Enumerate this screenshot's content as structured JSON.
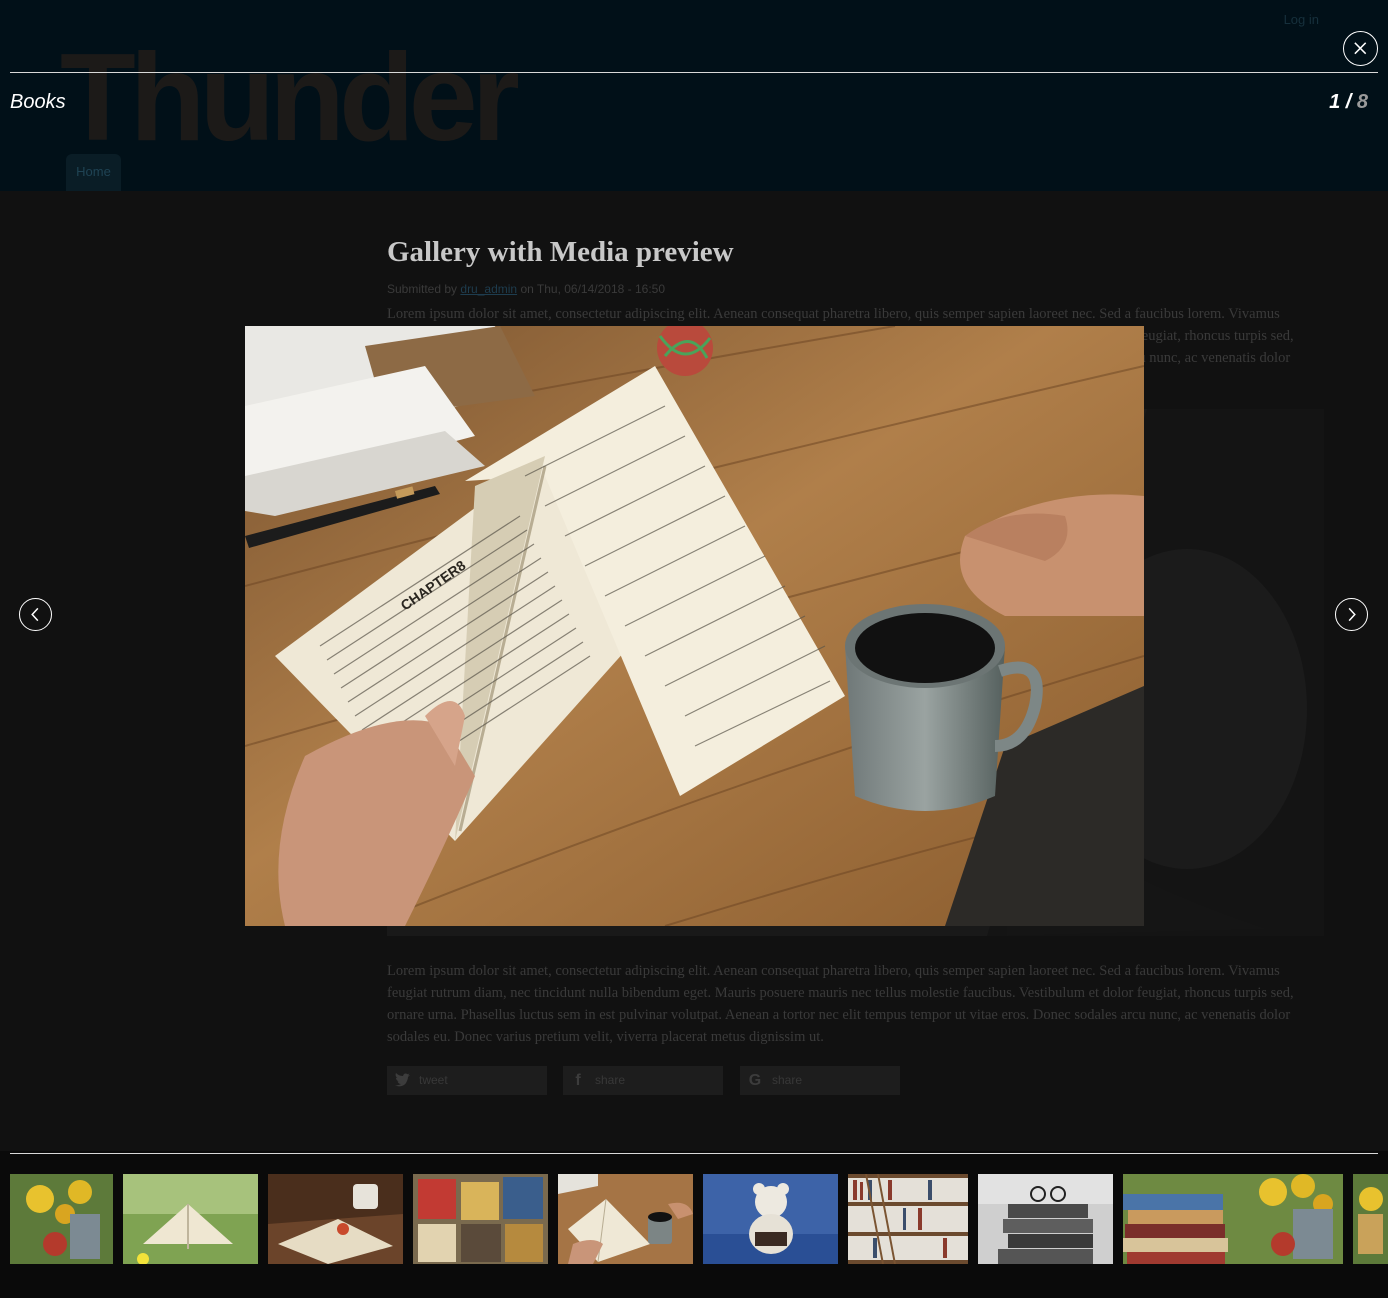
{
  "header": {
    "login_label": "Log in",
    "logo_text": "Thunder",
    "nav_home_label": "Home"
  },
  "article": {
    "title": "Gallery with Media preview",
    "submitted_prefix": "Submitted by",
    "author": "dru_admin",
    "submitted_suffix": "on Thu, 06/14/2018 - 16:50",
    "paragraph_top": "Lorem ipsum dolor sit amet, consectetur adipiscing elit. Aenean consequat pharetra libero, quis semper sapien laoreet nec. Sed a faucibus lorem. Vivamus feugiat rutrum diam, nec tincidunt nulla bibendum eget. Mauris posuere mauris nec tellus molestie faucibus. Vestibulum et dolor feugiat, rhoncus turpis sed, ornare urna. Phasellus luctus sem in est pulvinar volutpat. Aenean a tortor nec elit tempus tempor ut vitae eros. Donec sodales arcu nunc, ac venenatis dolor sodales eu.",
    "paragraph_bottom": "Lorem ipsum dolor sit amet, consectetur adipiscing elit. Aenean consequat pharetra libero, quis semper sapien laoreet nec. Sed a faucibus lorem. Vivamus feugiat rutrum diam, nec tincidunt nulla bibendum eget. Mauris posuere mauris nec tellus molestie faucibus. Vestibulum et dolor feugiat, rhoncus turpis sed, ornare urna. Phasellus luctus sem in est pulvinar volutpat. Aenean a tortor nec elit tempus tempor ut vitae eros. Donec sodales arcu nunc, ac venenatis dolor sodales eu. Donec varius pretium velit, viverra placerat metus dignissim ut.",
    "share": {
      "twitter_label": "tweet",
      "facebook_label": "share",
      "google_label": "share"
    }
  },
  "lightbox": {
    "gallery_title": "Books",
    "counter_current": "1",
    "counter_sep": " / ",
    "counter_total": "8",
    "close_icon": "close-icon",
    "prev_icon": "chevron-left-icon",
    "next_icon": "chevron-right-icon",
    "thumbnails": [
      {
        "name": "thumb-flowers-apple"
      },
      {
        "name": "thumb-open-book-grass"
      },
      {
        "name": "thumb-book-tea"
      },
      {
        "name": "thumb-magazines"
      },
      {
        "name": "thumb-book-coffee",
        "active": true
      },
      {
        "name": "thumb-teddy-bear"
      },
      {
        "name": "thumb-library-shelves"
      },
      {
        "name": "thumb-stacked-books-glasses"
      },
      {
        "name": "thumb-books-flowers"
      },
      {
        "name": "thumb-partial"
      }
    ]
  },
  "colors": {
    "overlay_bg": "#0a0a0a",
    "header_bg": "#011018",
    "counter_total": "#9a9a9a",
    "text_white": "#ffffff"
  }
}
